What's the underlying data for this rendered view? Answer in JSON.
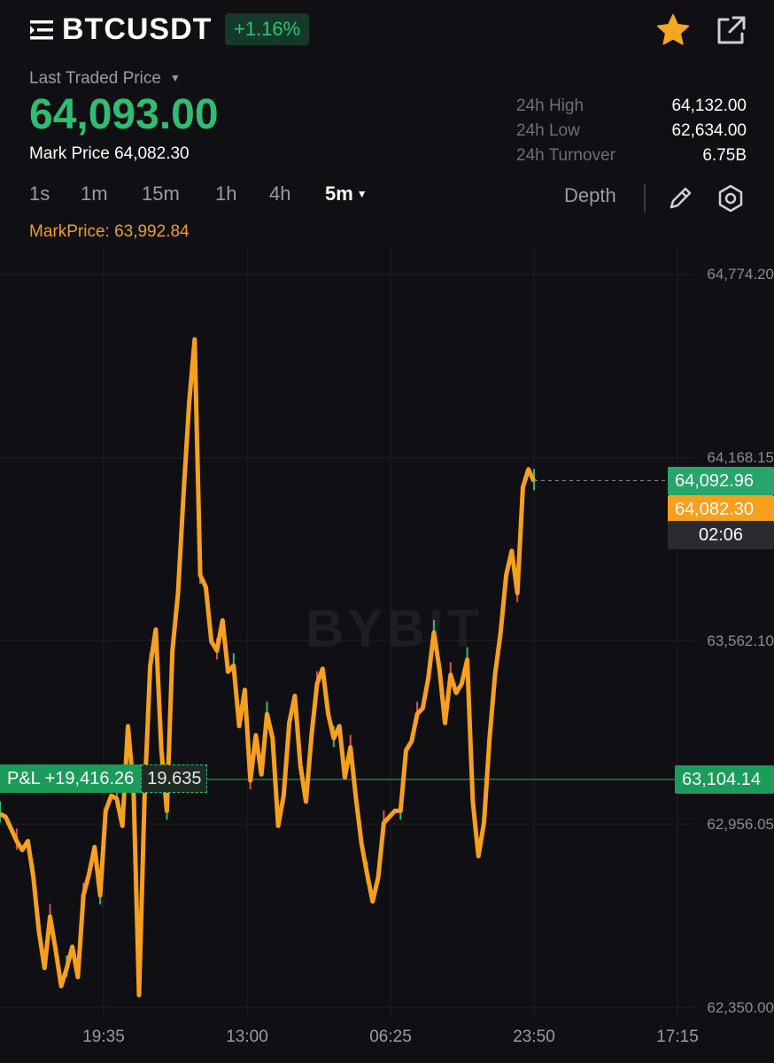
{
  "header": {
    "symbol": "BTCUSDT",
    "change_pct": "+1.16%",
    "icons": {
      "menu": "menu-icon",
      "favorite": "star-icon",
      "share": "external-link-icon"
    }
  },
  "ticker": {
    "last_price_label": "Last Traded Price",
    "last_price": "64,093.00",
    "mark_label": "Mark Price",
    "mark_value": "64,082.30",
    "stats": [
      {
        "label": "24h High",
        "value": "64,132.00"
      },
      {
        "label": "24h Low",
        "value": "62,634.00"
      },
      {
        "label": "24h Turnover",
        "value": "6.75B"
      }
    ]
  },
  "toolbar": {
    "intervals": [
      "1s",
      "1m",
      "15m",
      "1h",
      "4h"
    ],
    "active_interval": "5m",
    "depth_label": "Depth",
    "icons": {
      "draw": "pencil-icon",
      "settings": "settings-icon"
    }
  },
  "indicator": {
    "label": "MarkPrice:",
    "value": "63,992.84"
  },
  "chart_data": {
    "type": "line",
    "x_ticks": [
      "19:35",
      "13:00",
      "06:25",
      "23:50",
      "17:15"
    ],
    "y_ticks": [
      "64,774.20",
      "64,168.15",
      "63,562.10",
      "62,956.05",
      "62,350.00"
    ],
    "ylim": [
      62350.0,
      64774.2
    ],
    "watermark": "BYBIT",
    "last_price_tag": "64,092.96",
    "mark_price_tag": "64,082.30",
    "countdown": "02:06",
    "position_line": "63,104.14",
    "pnl_label": "P&L +19,416.26",
    "position_qty": "19.635",
    "series": [
      {
        "color": "#f7a01e",
        "values": [
          62990,
          62980,
          62940,
          62900,
          62870,
          62900,
          62780,
          62600,
          62480,
          62650,
          62540,
          62420,
          62480,
          62550,
          62450,
          62720,
          62790,
          62880,
          62720,
          63000,
          63050,
          63040,
          62950,
          63280,
          63070,
          62390,
          63050,
          63480,
          63600,
          63200,
          63000,
          63530,
          63720,
          64050,
          64350,
          64560,
          63780,
          63740,
          63560,
          63530,
          63630,
          63460,
          63480,
          63280,
          63400,
          63100,
          63250,
          63120,
          63320,
          63240,
          62950,
          63050,
          63290,
          63380,
          63150,
          63030,
          63250,
          63420,
          63470,
          63320,
          63240,
          63280,
          63110,
          63210,
          63040,
          62890,
          62790,
          62700,
          62780,
          62960,
          62980,
          63000,
          63000,
          63200,
          63230,
          63320,
          63340,
          63440,
          63590,
          63470,
          63290,
          63450,
          63390,
          63420,
          63500,
          63030,
          62850,
          62960,
          63240,
          63450,
          63590,
          63780,
          63860,
          63720,
          64070,
          64130,
          64090
        ]
      }
    ]
  }
}
